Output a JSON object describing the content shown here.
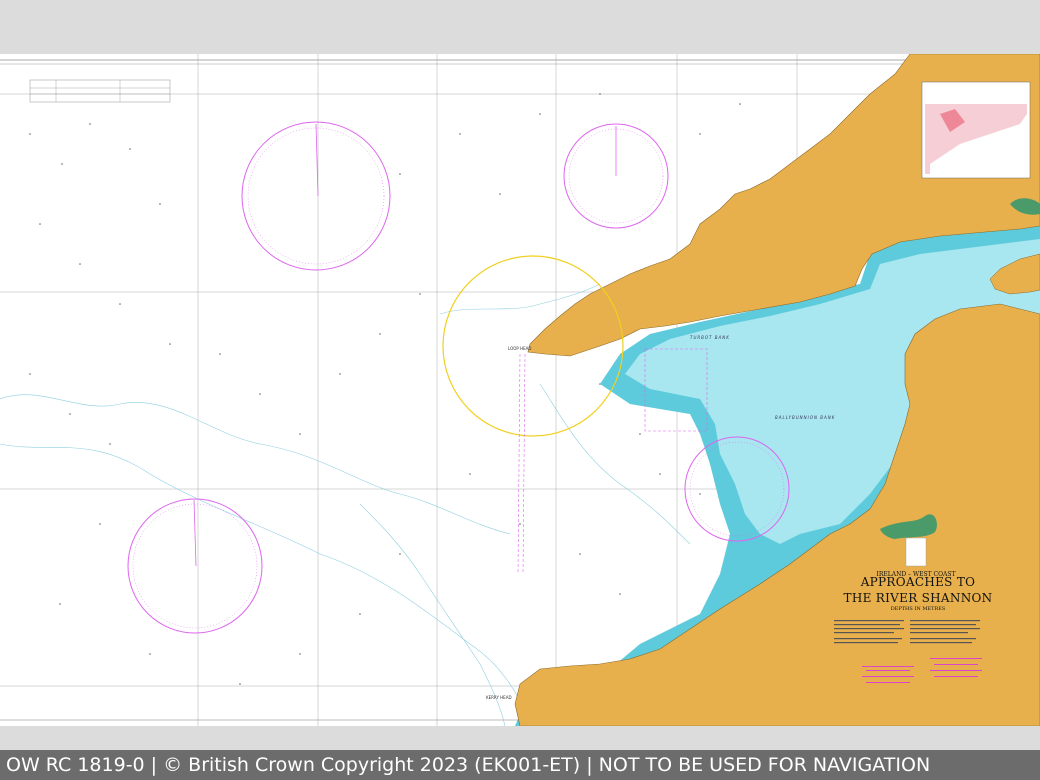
{
  "chart": {
    "region": "IRELAND – WEST COAST",
    "title_line_1": "APPROACHES TO",
    "title_line_2": "THE RIVER SHANNON",
    "depths_note": "DEPTHS IN METRES",
    "place_labels": {
      "loop_head": "LOOP HEAD",
      "turbot_bank": "TURBOT BANK",
      "ballybunnion_bank": "BALLYBUNNION BANK",
      "kerry_head": "KERRY HEAD"
    }
  },
  "caption": {
    "text": "OW RC 1819-0 | © British Crown Copyright 2023 (EK001-ET) | NOT TO BE USED FOR NAVIGATION"
  },
  "colors": {
    "land": "#e8b04c",
    "shallow_water": "#9fe3ee",
    "deep_shallow_water": "#5dcbdb",
    "sea": "#ffffff",
    "compass_rose": "#dd66ee",
    "loop_head_circle": "#f0d020",
    "caption_bar": "#6c6c6c"
  }
}
